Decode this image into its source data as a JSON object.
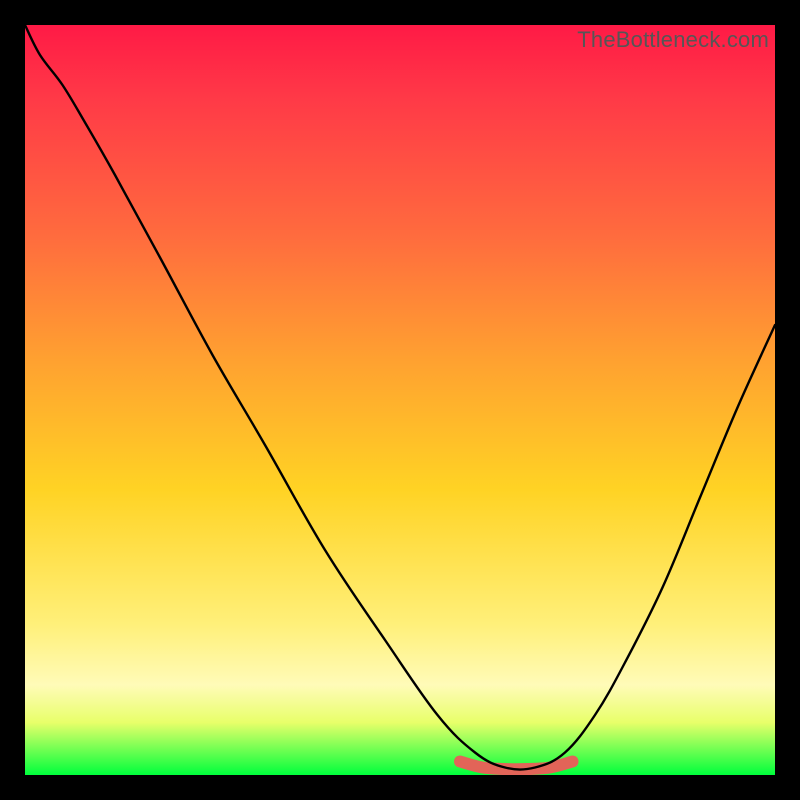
{
  "watermark": "TheBottleneck.com",
  "colors": {
    "frame": "#000000",
    "bump": "#e26458",
    "curve": "#000000",
    "gradient": [
      "#ff1a46",
      "#ff6b3e",
      "#ffd324",
      "#fffbb8",
      "#00ff3c"
    ]
  },
  "chart_data": {
    "type": "line",
    "title": "",
    "xlabel": "",
    "ylabel": "",
    "xlim": [
      0,
      100
    ],
    "ylim": [
      0,
      100
    ],
    "grid": false,
    "legend": false,
    "series": [
      {
        "name": "main-curve",
        "x": [
          0,
          2,
          5,
          8,
          12,
          18,
          25,
          32,
          40,
          48,
          55,
          60,
          64,
          68,
          72,
          76,
          80,
          85,
          90,
          95,
          100
        ],
        "y": [
          100,
          96,
          92,
          87,
          80,
          69,
          56,
          44,
          30,
          18,
          8,
          3,
          1,
          1,
          3,
          8,
          15,
          25,
          37,
          49,
          60
        ]
      },
      {
        "name": "valley-bump",
        "x": [
          58,
          61,
          64,
          67,
          70,
          73
        ],
        "y": [
          1.8,
          1.0,
          0.8,
          0.8,
          1.0,
          1.8
        ]
      }
    ],
    "notes": "Axes unlabeled in source image; values are normalized 0–100 estimates read from the plot geometry. Background is a vertical red→green gradient; a short salmon-colored thick stroke marks the valley floor."
  }
}
